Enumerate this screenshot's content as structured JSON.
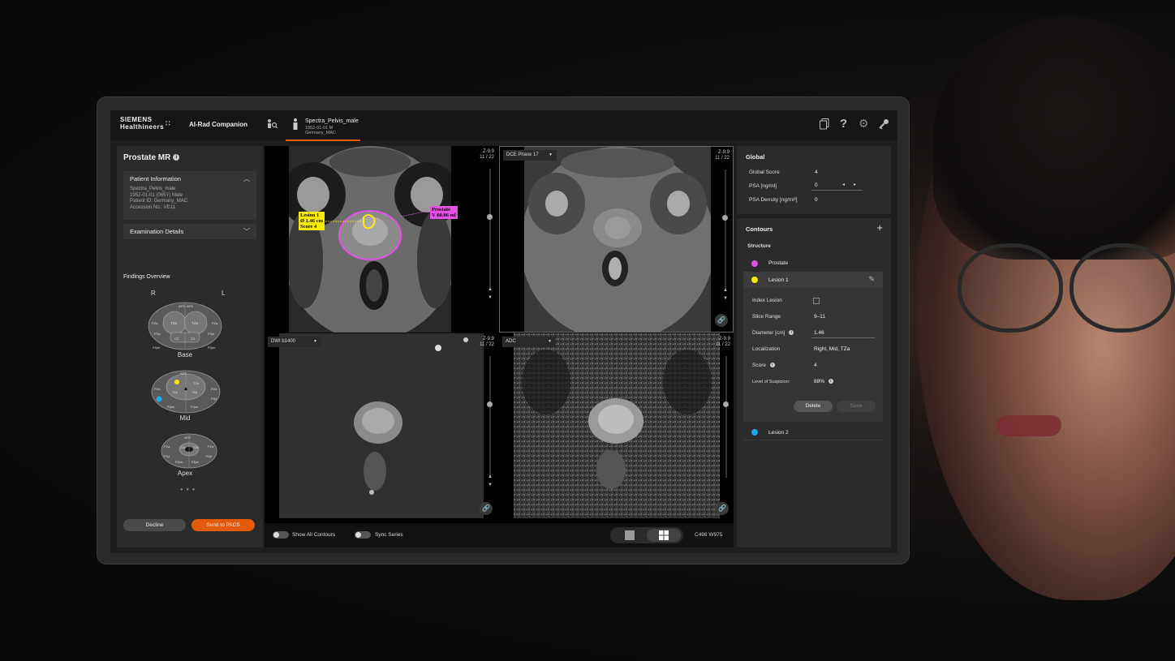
{
  "app": {
    "brand_line1": "SIEMENS",
    "brand_line2": "Healthineers",
    "brand_dots": "∷",
    "name": "AI-Rad Companion",
    "accent": "#e35a0b"
  },
  "patient_tab": {
    "name": "Spectra_Pelvis_male",
    "details": "1952-01-01 M Germany_MAC"
  },
  "top_icons": [
    "patient-search-icon",
    "documents-icon",
    "help-icon",
    "settings-icon",
    "key-icon"
  ],
  "left": {
    "title": "Prostate MR",
    "patient_info": {
      "header": "Patient Information",
      "lines": [
        "Spectra_Pelvis_male",
        "1952-01-01 (065Y) Male",
        "Patient ID: Germany_MAC",
        "Accession No.: VE11"
      ]
    },
    "exam_details": "Examination Details",
    "findings_title": "Findings Overview",
    "side_right": "R",
    "side_left": "L",
    "sectors": [
      {
        "label": "Base"
      },
      {
        "label": "Mid"
      },
      {
        "label": "Apex"
      }
    ],
    "pager": "● ● ●",
    "decline": "Decline",
    "send": "Send to PACS"
  },
  "viewer": {
    "viewports": [
      {
        "series": "",
        "z": "Z-9.9",
        "slice": "11 / 22"
      },
      {
        "series": "DCE Phase 17",
        "z": "Z-9.9",
        "slice": "11 / 22"
      },
      {
        "series": "DWI b1400",
        "z": "Z-9.9",
        "slice": "11 / 22"
      },
      {
        "series": "ADC",
        "z": "Z-9.9",
        "slice": "11 / 22"
      }
    ],
    "annotation_lesion": [
      "Lesion 1",
      "Ø 1.46 cm",
      "Score 4"
    ],
    "annotation_prostate": [
      "Prostate",
      "V 60.06 ml"
    ],
    "show_all_contours": "Show All Contours",
    "sync_series": "Sync Series",
    "window": "C498  W975"
  },
  "right": {
    "global_title": "Global",
    "global_rows": [
      {
        "label": "Global Score",
        "value": "4"
      },
      {
        "label": "PSA [ng/ml]",
        "value": "0"
      },
      {
        "label": "PSA Density [ng/ml²]",
        "value": "0"
      }
    ],
    "contours_title": "Contours",
    "structure_label": "Structure",
    "structures": [
      {
        "name": "Prostate",
        "color": "#e451e4"
      },
      {
        "name": "Lesion 1",
        "color": "#ffeb00"
      },
      {
        "name": "Lesion 2",
        "color": "#1aa8e6"
      }
    ],
    "lesion_details": [
      {
        "label": "Index Lesion",
        "value": ""
      },
      {
        "label": "Slice Range",
        "value": "9–11"
      },
      {
        "label": "Diameter [cm]",
        "value": "1.46"
      },
      {
        "label": "Localization",
        "value": "Right, Mid, TZa"
      },
      {
        "label": "Score",
        "value": "4"
      },
      {
        "label": "Level of Suspicion:",
        "value": "88%"
      }
    ],
    "delete": "Delete",
    "save": "Save"
  }
}
